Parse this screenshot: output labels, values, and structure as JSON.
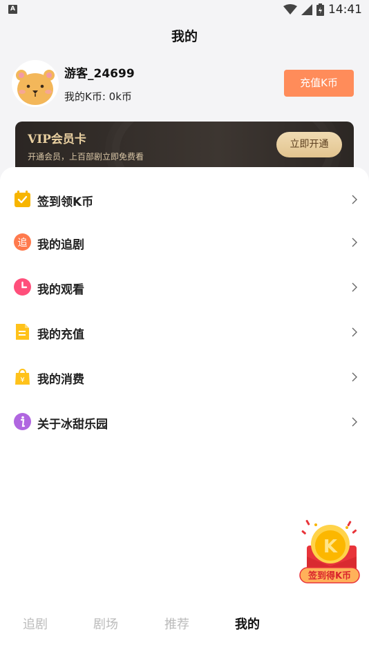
{
  "status_bar": {
    "notification_letter": "A",
    "time": "14:41"
  },
  "header": {
    "title": "我的"
  },
  "profile": {
    "username": "游客_24699",
    "coins_text": "我的K币: 0k币",
    "recharge_label": "充值K币"
  },
  "vip": {
    "title": "VIP会员卡",
    "subtitle": "开通会员，上百部剧立即免费看",
    "button_label": "立即开通"
  },
  "menu": {
    "items": [
      {
        "label": "签到领K币",
        "icon": "calendar-check-icon",
        "color": "#f7b500"
      },
      {
        "label": "我的追剧",
        "icon": "follow-badge-icon",
        "color": "#ff7a4d"
      },
      {
        "label": "我的观看",
        "icon": "clock-icon",
        "color": "#ff4f7b"
      },
      {
        "label": "我的充值",
        "icon": "document-icon",
        "color": "#ffc21a"
      },
      {
        "label": "我的消费",
        "icon": "shopping-bag-icon",
        "color": "#ffc21a"
      },
      {
        "label": "关于冰甜乐园",
        "icon": "info-icon",
        "color": "#b066e0"
      }
    ],
    "follow_glyph": "追"
  },
  "float_signin": {
    "label": "签到得K币",
    "coin_letter": "K"
  },
  "bottom_nav": {
    "items": [
      {
        "label": "追剧",
        "active": false
      },
      {
        "label": "剧场",
        "active": false
      },
      {
        "label": "推荐",
        "active": false
      },
      {
        "label": "我的",
        "active": true
      }
    ]
  }
}
